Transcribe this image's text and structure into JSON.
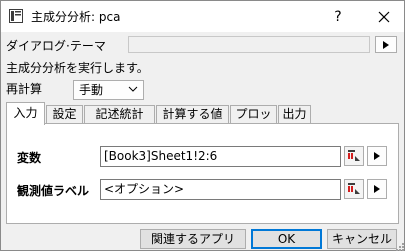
{
  "window": {
    "title": "主成分分析: pca",
    "help_label": "?"
  },
  "dialog_theme": {
    "label": "ダイアログ·テーマ",
    "value": ""
  },
  "description": "主成分分析を実行します。",
  "recalculate": {
    "label": "再計算",
    "value": "手動"
  },
  "tabs": [
    {
      "label": "入力",
      "active": true
    },
    {
      "label": "設定",
      "active": false
    },
    {
      "label": "記述統計",
      "active": false
    },
    {
      "label": "計算する値",
      "active": false
    },
    {
      "label": "プロット",
      "active": false
    },
    {
      "label": "出力",
      "active": false
    }
  ],
  "input_panel": {
    "variables": {
      "label": "変数",
      "value": "[Book3]Sheet1!2:6"
    },
    "observation_labels": {
      "label": "観測値ラベル",
      "value": "<オプション>"
    }
  },
  "buttons": {
    "related_apps": "関連するアプリ",
    "ok": "OK",
    "cancel": "キャンセル"
  },
  "colors": {
    "tab_border": "#adadad",
    "default_button_border": "#0078d7",
    "picker_red": "#d21f1f"
  }
}
